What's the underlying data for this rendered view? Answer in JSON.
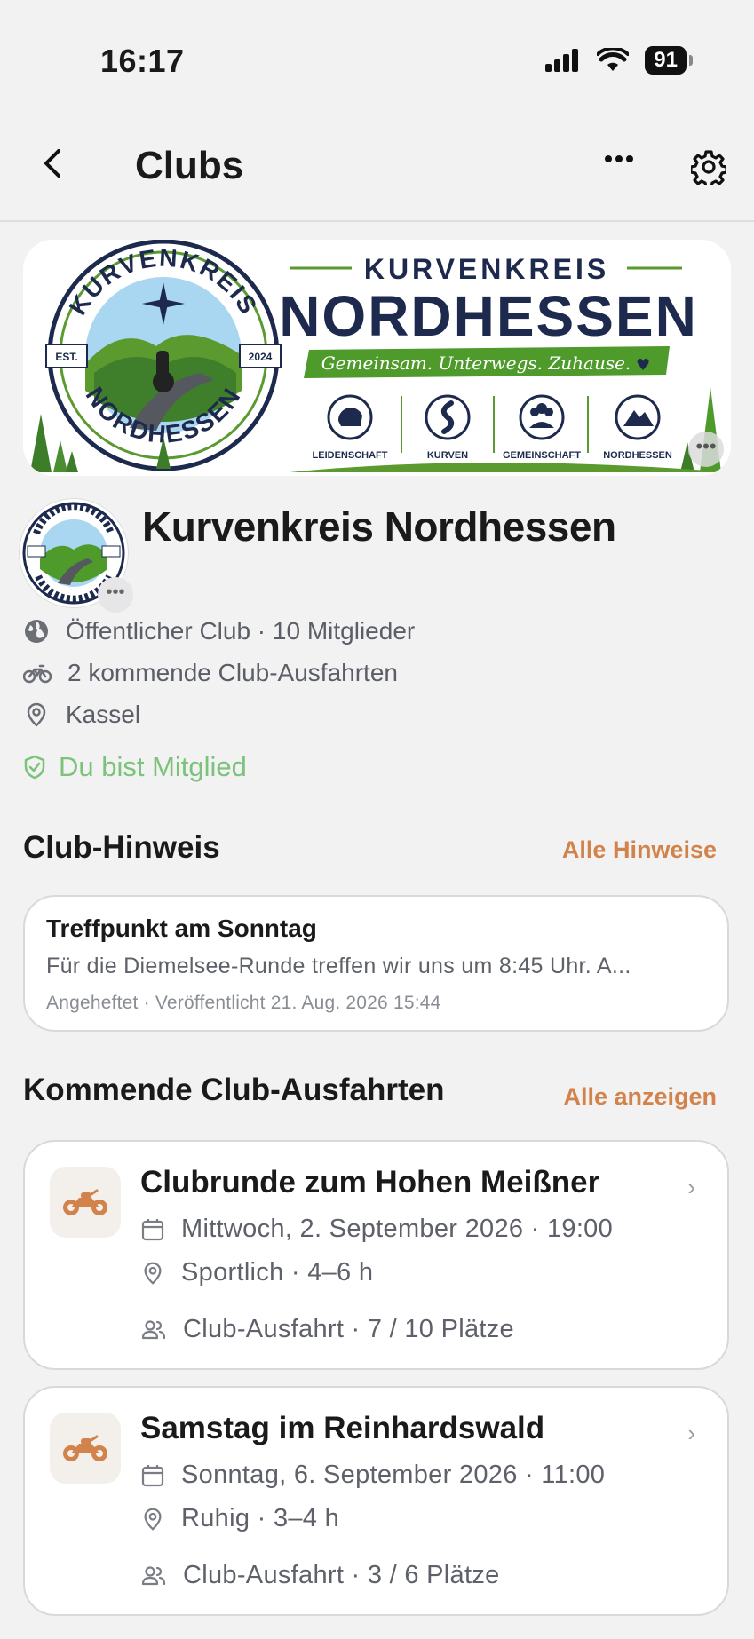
{
  "status_bar": {
    "time": "16:17",
    "battery": "91"
  },
  "nav": {
    "title": "Clubs"
  },
  "banner": {
    "top_text": "KURVENKREIS",
    "main_text": "NORDHESSEN",
    "slogan": "Gemeinsam. Unterwegs. Zuhause.",
    "badge_top": "KURVENKREIS",
    "badge_bottom": "NORDHESSEN",
    "badge_est": "EST.",
    "badge_year": "2024",
    "badges": [
      "LEIDENSCHAFT",
      "KURVEN",
      "GEMEINSCHAFT",
      "NORDHESSEN"
    ]
  },
  "club": {
    "name": "Kurvenkreis Nordhessen",
    "visibility": "Öffentlicher Club · 10 Mitglieder",
    "upcoming": "2 kommende Club-Ausfahrten",
    "location": "Kassel",
    "membership": "Du bist Mitglied"
  },
  "notice_section": {
    "title": "Club-Hinweis",
    "link": "Alle Hinweise",
    "card": {
      "title": "Treffpunkt am Sonntag",
      "text": "Für die Diemelsee-Runde treffen wir uns um 8:45 Uhr. A...",
      "meta": "Angeheftet · Veröffentlicht 21. Aug. 2026 15:44"
    }
  },
  "rides_section": {
    "title": "Kommende Club-Ausfahrten",
    "link": "Alle anzeigen",
    "rides": [
      {
        "title": "Clubrunde zum Hohen Meißner",
        "date": "Mittwoch, 2. September 2026 · 19:00",
        "style": "Sportlich · 4–6 h",
        "seats": "Club-Ausfahrt · 7 / 10 Plätze"
      },
      {
        "title": "Samstag im Reinhardswald",
        "date": "Sonntag, 6. September 2026 · 11:00",
        "style": "Ruhig · 3–4 h",
        "seats": "Club-Ausfahrt · 3 / 6 Plätze"
      }
    ]
  },
  "colors": {
    "accent": "#d2834b",
    "member_green": "#7cc27a",
    "navy": "#1d2a4d",
    "banner_green": "#5a9a2e"
  }
}
